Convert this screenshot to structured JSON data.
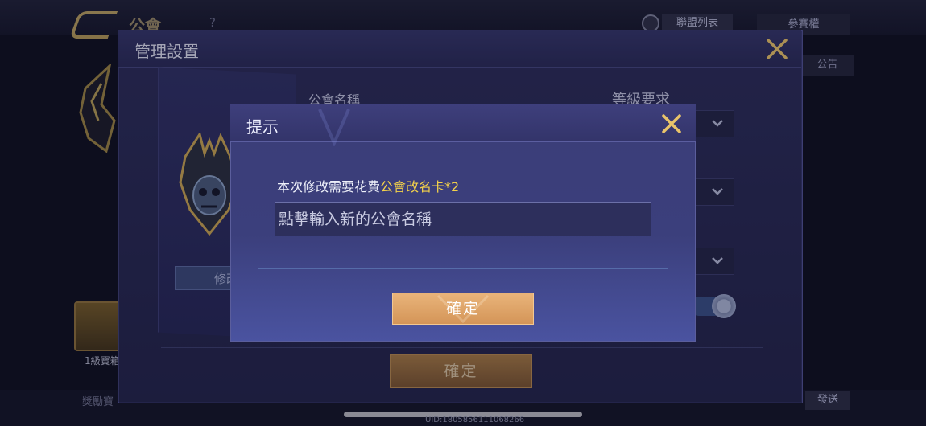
{
  "background": {
    "page_title": "公會",
    "help_mark": "?",
    "tab_ranked_list": "聯盟列表",
    "tab_right": "參賽權",
    "tab_right_2": "公告",
    "chest_label": "1級寶箱",
    "bottom_left_label": "獎勵寶",
    "send_button": "發送",
    "uid_text": "UID:1805856111068266"
  },
  "panel": {
    "title": "管理設置",
    "guild_name_label": "公會名稱",
    "level_requirement_label": "等級要求",
    "modify_button": "修改",
    "confirm_button": "確定"
  },
  "dialog": {
    "title": "提示",
    "cost_prefix": "本次修改需要花費",
    "cost_item": "公會改名卡*2",
    "input_value": "",
    "input_placeholder": "點擊輸入新的公會名稱",
    "confirm_button": "確定"
  },
  "colors": {
    "accent_gold": "#f3d14a",
    "confirm_orange": "#d49558",
    "close_x": "#e9c46a"
  }
}
